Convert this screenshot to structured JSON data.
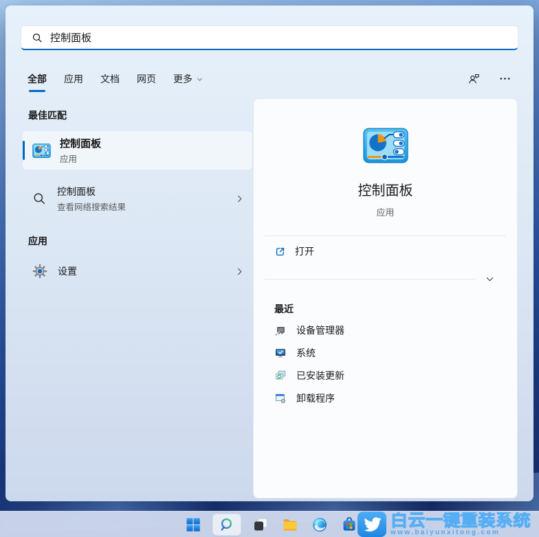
{
  "search_box": {
    "value": "控制面板",
    "icon": "search-icon"
  },
  "tabs": {
    "items": [
      {
        "label": "全部",
        "selected": true
      },
      {
        "label": "应用",
        "selected": false
      },
      {
        "label": "文档",
        "selected": false
      },
      {
        "label": "网页",
        "selected": false
      },
      {
        "label": "更多",
        "selected": false,
        "has_dropdown": true
      }
    ]
  },
  "header_actions": {
    "feedback_icon": "user-feedback-icon",
    "more_icon": "ellipsis-icon"
  },
  "left_panel": {
    "best_match_header": "最佳匹配",
    "best_match": {
      "title": "控制面板",
      "subtitle": "应用",
      "icon": "control-panel-icon"
    },
    "web_search": {
      "title": "控制面板",
      "subtitle": "查看网络搜索结果",
      "icon": "search-icon"
    },
    "apps_header": "应用",
    "apps": [
      {
        "label": "设置",
        "icon": "settings-gear-icon"
      }
    ]
  },
  "detail_panel": {
    "app_name": "控制面板",
    "app_type": "应用",
    "icon": "control-panel-icon",
    "open_action": {
      "label": "打开",
      "icon": "open-external-icon"
    },
    "recent_header": "最近",
    "recent_items": [
      {
        "label": "设备管理器",
        "icon": "device-manager-icon"
      },
      {
        "label": "系统",
        "icon": "system-monitor-icon"
      },
      {
        "label": "已安装更新",
        "icon": "installed-updates-icon"
      },
      {
        "label": "卸载程序",
        "icon": "uninstall-program-icon"
      }
    ]
  },
  "taskbar": {
    "items": [
      {
        "name": "start",
        "icon": "windows-start-icon"
      },
      {
        "name": "search",
        "icon": "search-icon",
        "active": true
      },
      {
        "name": "task-view",
        "icon": "task-view-icon"
      },
      {
        "name": "file-explorer",
        "icon": "folder-icon"
      },
      {
        "name": "edge",
        "icon": "edge-browser-icon"
      },
      {
        "name": "store",
        "icon": "microsoft-store-icon"
      }
    ]
  },
  "watermark": {
    "brand": "白云一键重装系统",
    "url": "www.baiyunxitong.com",
    "icon": "bird-icon"
  },
  "colors": {
    "accent": "#0067c0",
    "taskbar_bg": "#ccd7ec",
    "watermark_blue": "#4da9ef"
  }
}
